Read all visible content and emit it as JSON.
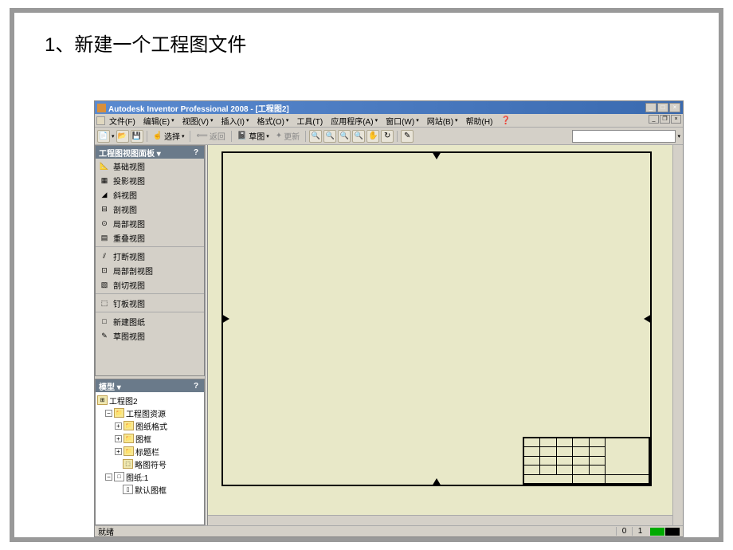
{
  "slide": {
    "heading": "1、新建一个工程图文件"
  },
  "titlebar": {
    "text": "Autodesk Inventor Professional 2008 - [工程图2]"
  },
  "menu": {
    "file": "文件(F)",
    "edit": "编辑(E)",
    "view": "视图(V)",
    "insert": "插入(I)",
    "format": "格式(O)",
    "tools": "工具(T)",
    "application": "应用程序(A)",
    "window": "窗口(W)",
    "web": "网站(B)",
    "help": "帮助(H)"
  },
  "toolbar": {
    "select": "选择",
    "back": "返回",
    "sketch": "草图",
    "update": "更新"
  },
  "panel_views": {
    "title": "工程图视图面板",
    "items": [
      {
        "label": "基础视图",
        "icon": "📐"
      },
      {
        "label": "投影视图",
        "icon": "▦"
      },
      {
        "label": "斜视图",
        "icon": "◢"
      },
      {
        "label": "剖视图",
        "icon": "⊟"
      },
      {
        "label": "局部视图",
        "icon": "⊙"
      },
      {
        "label": "重叠视图",
        "icon": "▤"
      }
    ],
    "items2": [
      {
        "label": "打断视图",
        "icon": "⫽"
      },
      {
        "label": "局部剖视图",
        "icon": "⊡"
      },
      {
        "label": "剖切视图",
        "icon": "▧"
      }
    ],
    "items3": [
      {
        "label": "钉板视图",
        "icon": "⬚"
      }
    ],
    "items4": [
      {
        "label": "新建图纸",
        "icon": "□"
      },
      {
        "label": "草图视图",
        "icon": "✎"
      }
    ]
  },
  "panel_model": {
    "title": "模型",
    "root": "工程图2",
    "nodes": {
      "resources": "工程图资源",
      "sheet_formats": "图纸格式",
      "borders": "图框",
      "title_blocks": "标题栏",
      "sketch_symbols": "略图符号",
      "sheet": "图纸:1",
      "default_border": "默认图框"
    }
  },
  "statusbar": {
    "text": "就绪",
    "n0": "0",
    "n1": "1"
  }
}
